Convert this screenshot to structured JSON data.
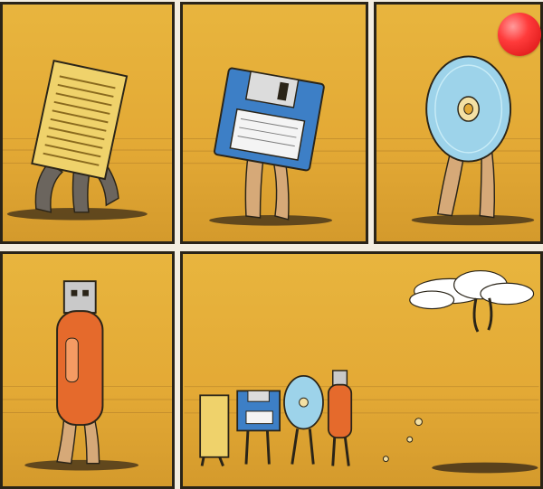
{
  "title": "",
  "panels": [
    {
      "subject": "punched-card",
      "walker": "hairy-legs-knuckles"
    },
    {
      "subject": "floppy-disk",
      "walker": "hairy-legs"
    },
    {
      "subject": "compact-disc",
      "walker": "hairy-legs"
    },
    {
      "subject": "usb-flash-drive",
      "walker": "hairy-legs"
    },
    {
      "subject": "lineup-to-cloud",
      "walker": "procession"
    }
  ],
  "colors": {
    "sand": "#e3a935",
    "ink": "#2a2418",
    "floppy": "#3d7fc6",
    "cd": "#9dd3ea",
    "usb": "#e56a2c",
    "card": "#efd26b",
    "badge": "#ff3b3b"
  },
  "icons": [
    "punched-card-icon",
    "floppy-disk-icon",
    "compact-disc-icon",
    "usb-drive-icon",
    "cloud-icon",
    "notification-dot-icon"
  ]
}
